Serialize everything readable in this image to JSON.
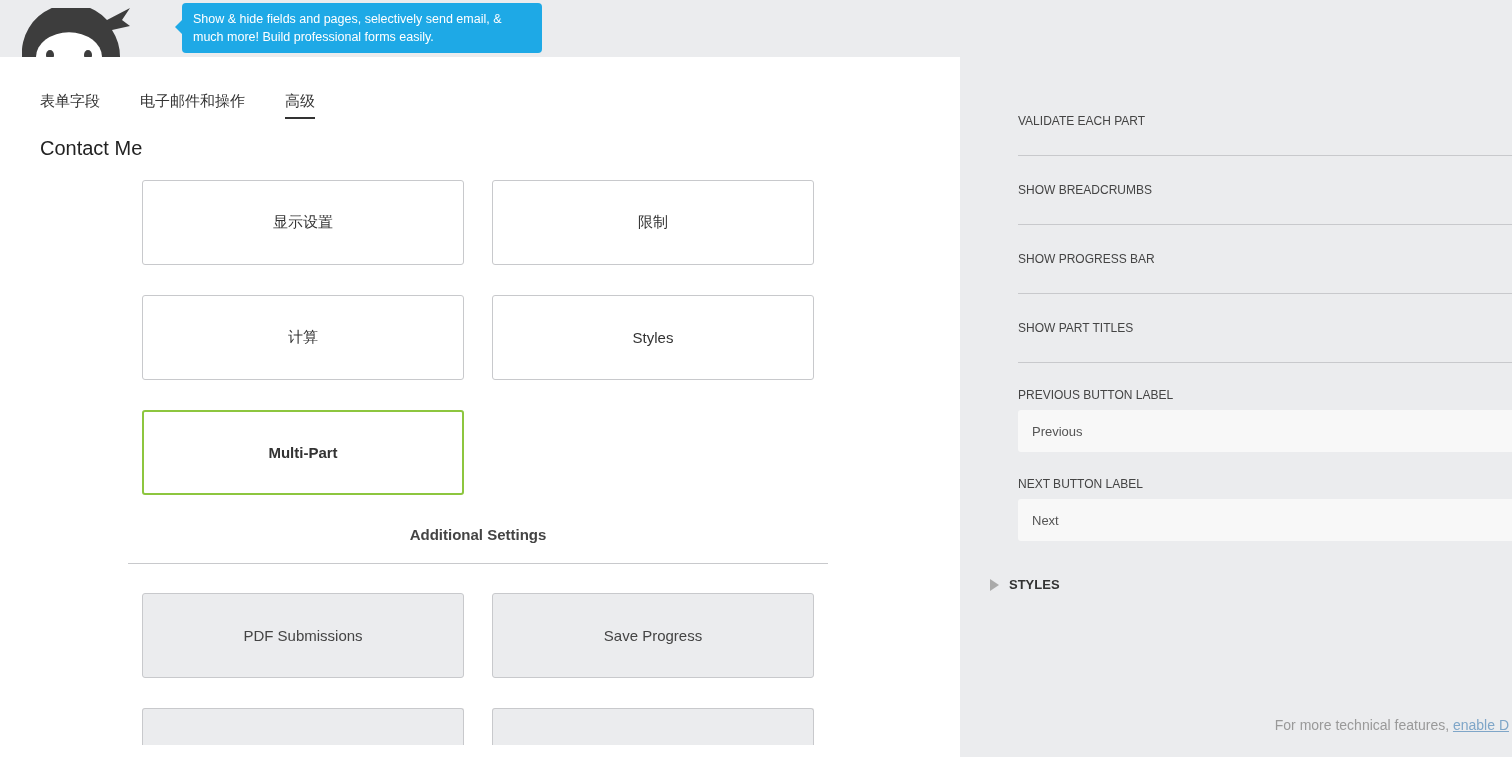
{
  "tooltip": {
    "text": "Show & hide fields and pages, selectively send email, & much more! Build professional forms easily."
  },
  "tabs": [
    {
      "label": "表单字段",
      "selected": false
    },
    {
      "label": "电子邮件和操作",
      "selected": false
    },
    {
      "label": "高级",
      "selected": true
    }
  ],
  "form_title": "Contact Me",
  "settings_cards": [
    {
      "label": "显示设置",
      "selected": false
    },
    {
      "label": "限制",
      "selected": false
    },
    {
      "label": "计算",
      "selected": false
    },
    {
      "label": "Styles",
      "selected": false
    },
    {
      "label": "Multi-Part",
      "selected": true
    }
  ],
  "additional_settings": {
    "heading": "Additional Settings",
    "cards": [
      {
        "kind": "full",
        "label": "PDF Submissions"
      },
      {
        "kind": "full",
        "label": "Save Progress"
      },
      {
        "kind": "cut"
      },
      {
        "kind": "cut"
      }
    ]
  },
  "side_panel": {
    "rows": [
      {
        "kind": "toggle",
        "label": "VALIDATE EACH PART"
      },
      {
        "kind": "toggle",
        "label": "SHOW BREADCRUMBS"
      },
      {
        "kind": "toggle",
        "label": "SHOW PROGRESS BAR"
      },
      {
        "kind": "toggle",
        "label": "SHOW PART TITLES"
      },
      {
        "kind": "input",
        "label": "PREVIOUS BUTTON LABEL",
        "value": "Previous"
      },
      {
        "kind": "input",
        "label": "NEXT BUTTON LABEL",
        "value": "Next"
      }
    ],
    "section": {
      "label": "STYLES",
      "expanded": false
    },
    "footer": {
      "text": "For more technical features,",
      "link": "enable D"
    }
  }
}
